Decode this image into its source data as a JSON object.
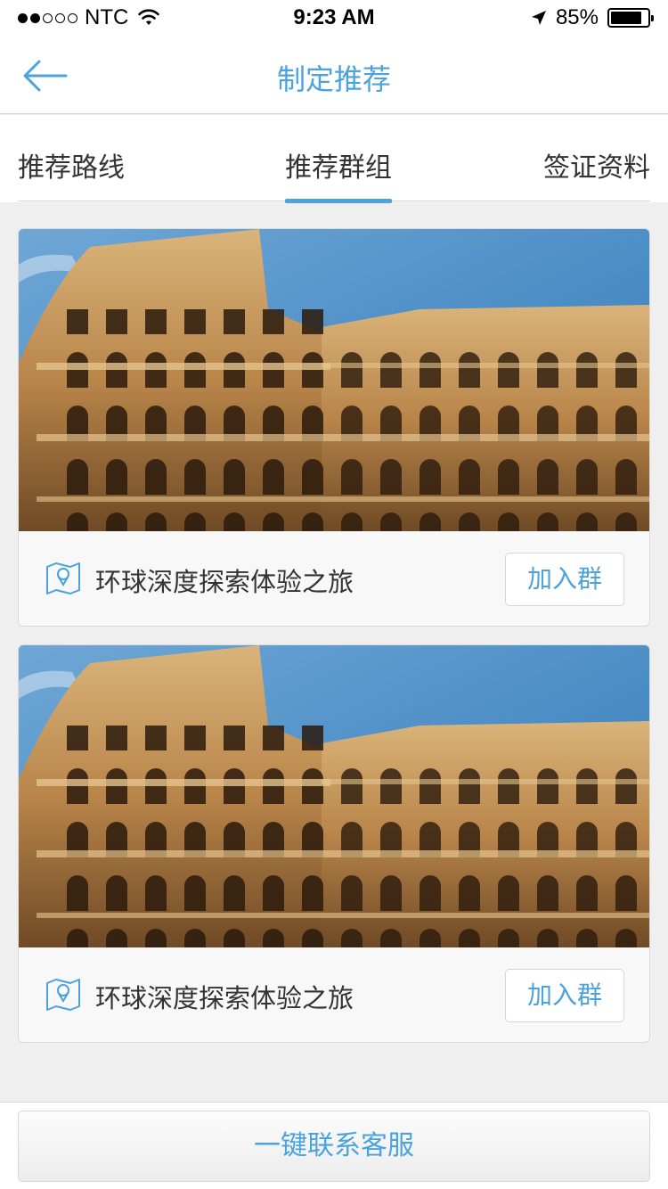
{
  "status_bar": {
    "carrier": "NTC",
    "signal_bars_filled": 2,
    "signal_bars_total": 5,
    "time": "9:23 AM",
    "battery": "85%",
    "battery_level": 0.85
  },
  "nav": {
    "title": "制定推荐",
    "back_icon": "arrow-left-icon"
  },
  "tabs": [
    {
      "label": "推荐路线",
      "active": false
    },
    {
      "label": "推荐群组",
      "active": true
    },
    {
      "label": "签证资料",
      "active": false
    }
  ],
  "cards": [
    {
      "title": "环球深度探索体验之旅",
      "button": "加入群",
      "icon": "map-pin-icon"
    },
    {
      "title": "环球深度探索体验之旅",
      "button": "加入群",
      "icon": "map-pin-icon"
    }
  ],
  "bottom": {
    "contact_button": "一键联系客服"
  },
  "colors": {
    "accent": "#4aa3dc",
    "text": "#333333",
    "background": "#efefef"
  }
}
